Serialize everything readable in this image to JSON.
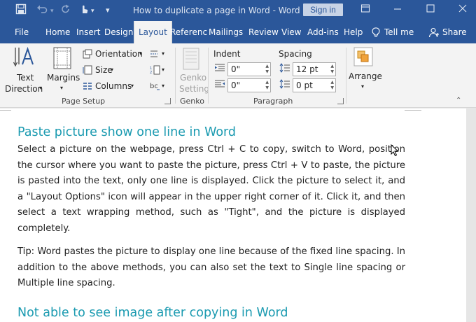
{
  "window": {
    "title": "How to duplicate a page in Word  -  Word",
    "sign_in_label": "Sign in",
    "tell_me": "Tell me",
    "share": "Share"
  },
  "tabs": [
    "File",
    "Home",
    "Insert",
    "Design",
    "Layout",
    "Referenc",
    "Mailings",
    "Review",
    "View",
    "Add-ins",
    "Help"
  ],
  "ribbon": {
    "text_direction": [
      "Text",
      "Direction"
    ],
    "margins": "Margins",
    "orientation": "Orientation",
    "size": "Size",
    "columns": "Columns",
    "page_setup_group": "Page Setup",
    "genko_setting": [
      "Genko",
      "Setting"
    ],
    "genko_group": "Genko",
    "indent_label": "Indent",
    "spacing_label": "Spacing",
    "indent_left": "0\"",
    "indent_right": "0\"",
    "spacing_before": "12 pt",
    "spacing_after": "0 pt",
    "paragraph_group": "Paragraph",
    "arrange": "Arrange"
  },
  "document": {
    "heading1": "Paste picture show one line in Word",
    "para1": "Select a picture on the webpage, press Ctrl + C to copy, switch to Word, position the cursor where you want to paste the picture, press Ctrl + V to paste, the picture is pasted into the text, only one line is displayed. Click the picture to select it, and a \"Layout Options\" icon will appear in the upper right corner of it. Click it, and then select a text wrapping method, such as \"Tight\", and the picture is displayed completely.",
    "para2": "Tip: Word pastes the picture to display one line because of the fixed line spacing. In addition to the above methods, you can also set the text to Single line spacing or Multiple line spacing.",
    "heading2": "Not able to see image after copying in Word"
  },
  "colors": {
    "titlebar": "#2b579a",
    "heading": "#1a9ab0",
    "ribbon": "#f3f3f3"
  }
}
